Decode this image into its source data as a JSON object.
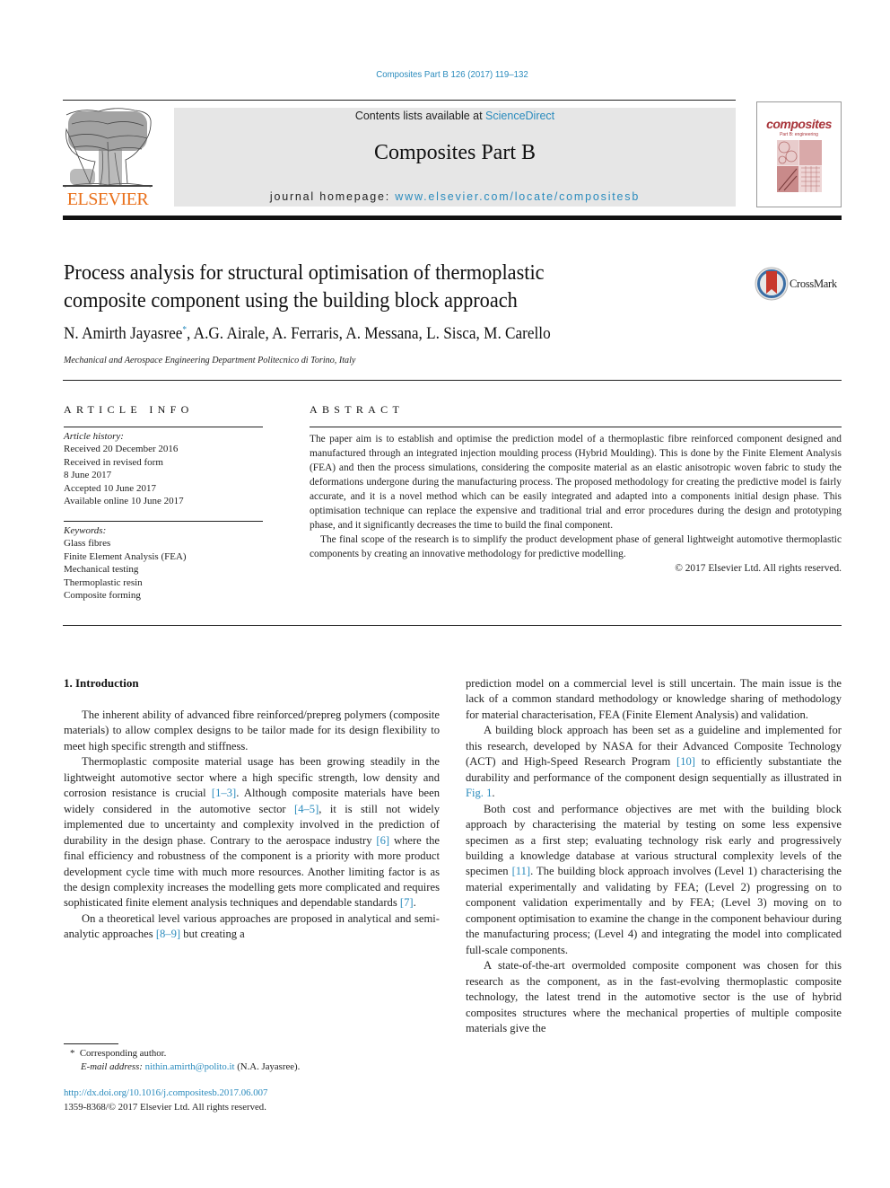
{
  "header": {
    "citation": "Composites Part B 126 (2017) 119–132",
    "contents_prefix": "Contents lists available at ",
    "contents_link": "ScienceDirect",
    "journal_name": "Composites Part B",
    "homepage_prefix": "journal homepage: ",
    "homepage_link": "www.elsevier.com/locate/compositesb",
    "publisher_logo_text": "ELSEVIER",
    "cover_title": "composites",
    "cover_subtitle": "Part B: engineering"
  },
  "colors": {
    "link": "#2a8bbd",
    "elsevier_orange": "#e9711c",
    "masthead_bg": "#e6e6e6",
    "cover_red": "#a8343a"
  },
  "article": {
    "title_line1": "Process analysis for structural optimisation of thermoplastic",
    "title_line2": "composite component using the building block approach",
    "crossmark_label": "CrossMark",
    "authors_first": "N. Amirth Jayasree",
    "authors_marker": "*",
    "authors_rest": ", A.G. Airale, A. Ferraris, A. Messana, L. Sisca, M. Carello",
    "affiliation": "Mechanical and Aerospace Engineering Department Politecnico di Torino, Italy"
  },
  "article_info": {
    "heading": "ARTICLE INFO",
    "history_label": "Article history:",
    "history": [
      "Received 20 December 2016",
      "Received in revised form",
      "8 June 2017",
      "Accepted 10 June 2017",
      "Available online 10 June 2017"
    ],
    "keywords_label": "Keywords:",
    "keywords": [
      "Glass fibres",
      "Finite Element Analysis (FEA)",
      "Mechanical testing",
      "Thermoplastic resin",
      "Composite forming"
    ]
  },
  "abstract": {
    "heading": "ABSTRACT",
    "paragraph1": "The paper aim is to establish and optimise the prediction model of a thermoplastic fibre reinforced component designed and manufactured through an integrated injection moulding process (Hybrid Moulding). This is done by the Finite Element Analysis (FEA) and then the process simulations, considering the composite material as an elastic anisotropic woven fabric to study the deformations undergone during the manufacturing process. The proposed methodology for creating the predictive model is fairly accurate, and it is a novel method which can be easily integrated and adapted into a components initial design phase. This optimisation technique can replace the expensive and traditional trial and error procedures during the design and prototyping phase, and it significantly decreases the time to build the final component.",
    "paragraph2": "The final scope of the research is to simplify the product development phase of general lightweight automotive thermoplastic components by creating an innovative methodology for predictive modelling.",
    "copyright": "© 2017 Elsevier Ltd. All rights reserved."
  },
  "body": {
    "section_title": "1.  Introduction",
    "left": {
      "p1": "The inherent ability of advanced fibre reinforced/prepreg polymers (composite materials) to allow complex designs to be tailor made for its design flexibility to meet high specific strength and stiffness.",
      "p2_a": "Thermoplastic composite material usage has been growing steadily in the lightweight automotive sector where a high specific strength, low density and corrosion resistance is crucial ",
      "p2_ref1": "[1–3]",
      "p2_b": ". Although composite materials have been widely considered in the automotive sector ",
      "p2_ref2": "[4–5]",
      "p2_c": ", it is still not widely implemented due to uncertainty and complexity involved in the prediction of durability in the design phase. Contrary to the aerospace industry ",
      "p2_ref3": "[6]",
      "p2_d": " where the final efficiency and robustness of the component is a priority with more product development cycle time with much more resources. Another limiting factor is as the design complexity increases the modelling gets more complicated and requires sophisticated finite element analysis techniques and dependable standards ",
      "p2_ref4": "[7]",
      "p2_e": ".",
      "p3_a": "On a theoretical level various approaches are proposed in analytical and semi-analytic approaches ",
      "p3_ref1": "[8–9]",
      "p3_b": " but creating a"
    },
    "right": {
      "p0": "prediction model on a commercial level is still uncertain. The main issue is the lack of a common standard methodology or knowledge sharing of methodology for material characterisation, FEA (Finite Element Analysis) and validation.",
      "p1_a": "A building block approach has been set as a guideline and implemented for this research, developed by NASA for their Advanced Composite Technology (ACT) and High-Speed Research Program ",
      "p1_ref1": "[10]",
      "p1_b": " to efficiently substantiate the durability and performance of the component design sequentially as illustrated in ",
      "p1_ref2": "Fig. 1",
      "p1_c": ".",
      "p2_a": "Both cost and performance objectives are met with the building block approach by characterising the material by testing on some less expensive specimen as a first step; evaluating technology risk early and progressively building a knowledge database at various structural complexity levels of the specimen ",
      "p2_ref1": "[11]",
      "p2_b": ". The building block approach involves (Level 1) characterising the material experimentally and validating by FEA; (Level 2) progressing on to component validation experimentally and by FEA; (Level 3) moving on to component optimisation to examine the change in the component behaviour during the manufacturing process; (Level 4) and integrating the model into complicated full-scale components.",
      "p3": "A state-of-the-art overmolded composite component was chosen for this research as the component, as in the fast-evolving thermoplastic composite technology, the latest trend in the automotive sector is the use of hybrid composites structures where the mechanical properties of multiple composite materials give the"
    }
  },
  "footnote": {
    "marker": "*",
    "corresponding": "Corresponding author.",
    "email_label": "E-mail address:",
    "email": "nithin.amirth@polito.it",
    "email_owner": " (N.A. Jayasree)."
  },
  "footer": {
    "doi": "http://dx.doi.org/10.1016/j.compositesb.2017.06.007",
    "issn_copyright": "1359-8368/© 2017 Elsevier Ltd. All rights reserved."
  }
}
